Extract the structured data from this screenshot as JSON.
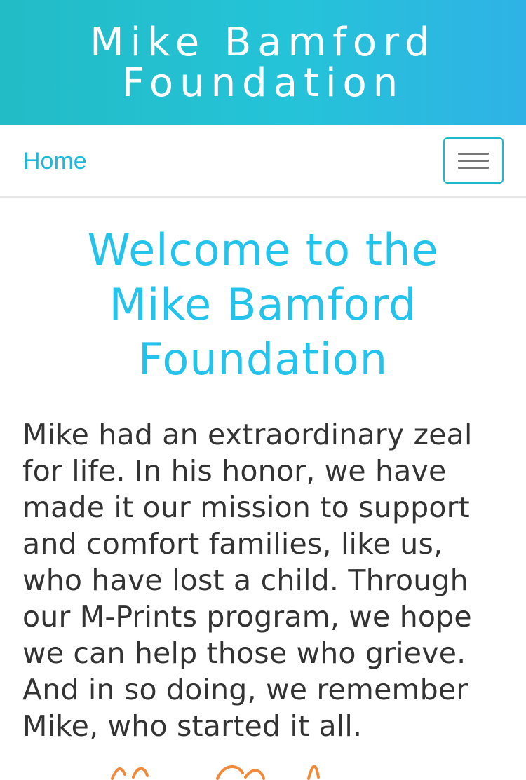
{
  "header": {
    "title_line1": "Mike Bamford",
    "title_line2": "Foundation"
  },
  "nav": {
    "home_label": "Home",
    "menu_icon": "hamburger-menu-icon"
  },
  "main": {
    "welcome_line1": "Welcome to the",
    "welcome_line2": "Mike Bamford",
    "welcome_line3": "Foundation",
    "intro": "Mike had an extraordinary zeal for life. In his honor, we have made it our mission to support and comfort families, like us, who have lost a child. Through our M-Prints program, we hope we can help those who grieve. And in so doing, we remember Mike, who started it all."
  },
  "colors": {
    "header_gradient_start": "#22bcc6",
    "header_gradient_end": "#2fb2e6",
    "accent": "#24c3ec",
    "body_text": "#333333",
    "signature": "#f08a3c"
  }
}
